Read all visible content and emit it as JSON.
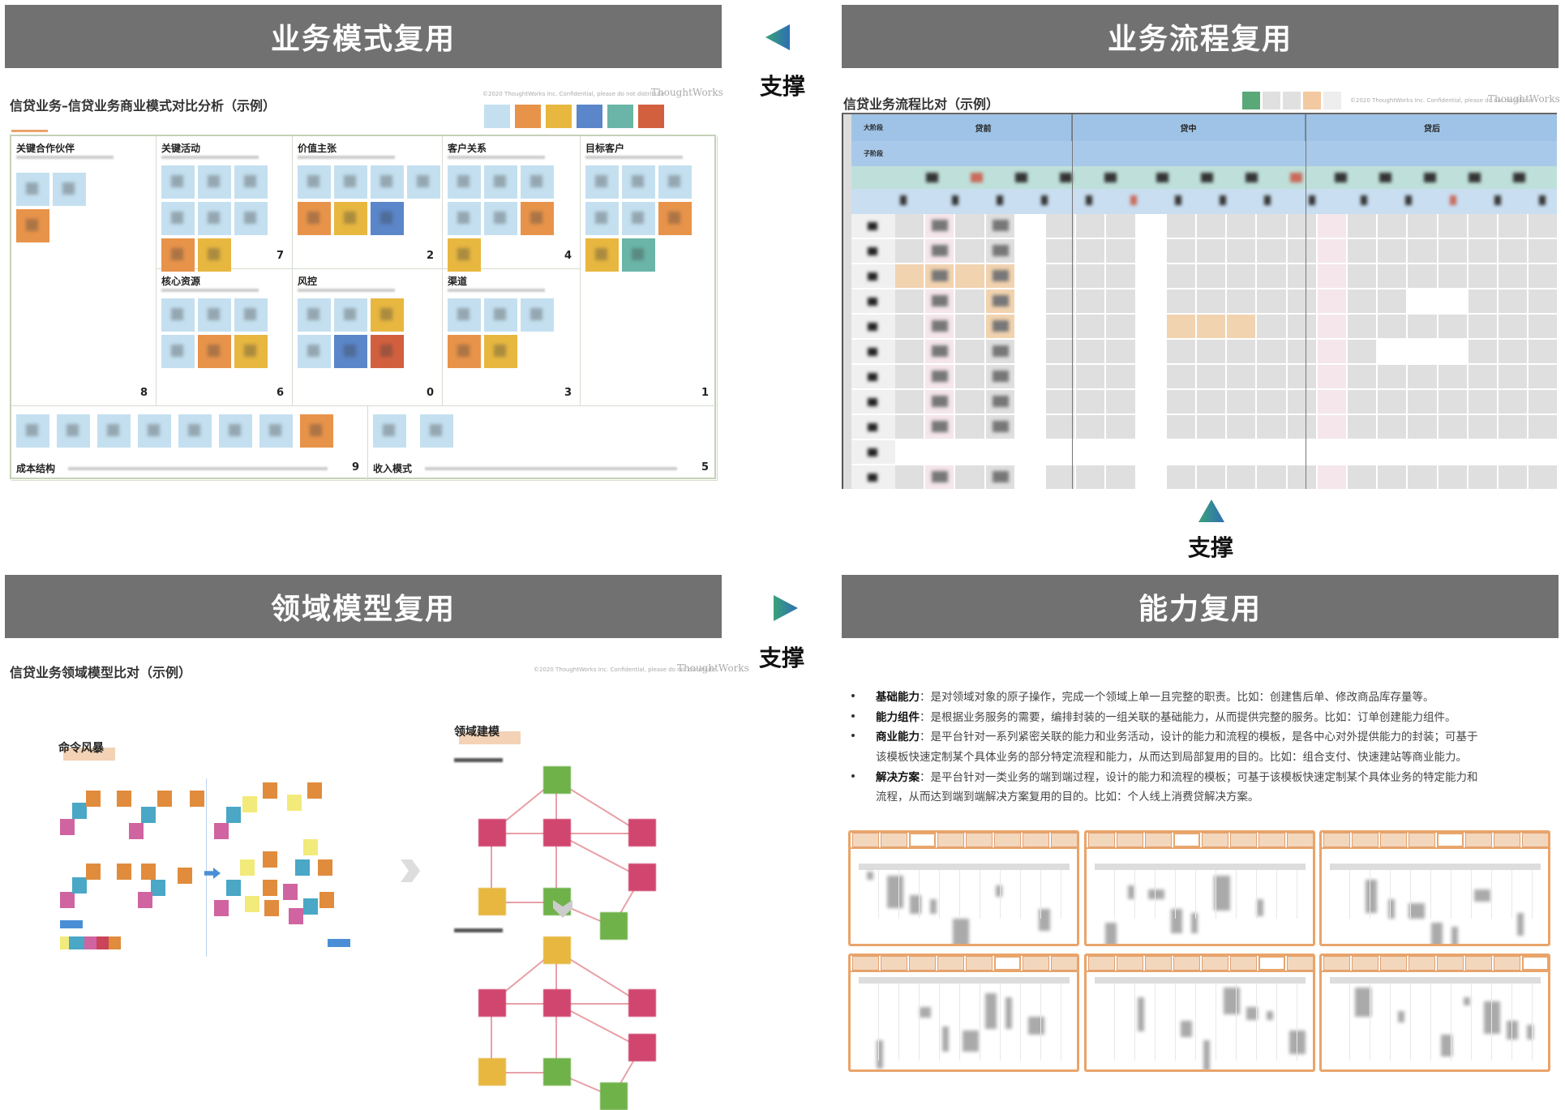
{
  "panels": {
    "business_model": {
      "header": "业务模式复用",
      "title": "信贷业务–信贷业务商业模式对比分析（示例）",
      "copyright": "©2020 ThoughtWorks Inc. Confidential, please do not distribute",
      "brand": "ThoughtWorks"
    },
    "business_process": {
      "header": "业务流程复用",
      "title": "信贷业务流程比对（示例）",
      "copyright": "©2020 ThoughtWorks Inc. Confidential, please do not distribute",
      "brand": "ThoughtWorks"
    },
    "domain_model": {
      "header": "领域模型复用",
      "title": "信贷业务领域模型比对（示例）",
      "copyright": "©2020 ThoughtWorks Inc. Confidential, please do not distribute",
      "brand": "ThoughtWorks",
      "left_label": "命令风暴",
      "right_label": "领域建模"
    },
    "capability": {
      "header": "能力复用"
    }
  },
  "support_label": "支撑",
  "canvas": {
    "legend_colors": [
      "#c4e0f0",
      "#e8934a",
      "#e7b740",
      "#5b86c9",
      "#6ab5a8",
      "#d2603f"
    ],
    "sections": [
      {
        "name": "关键合作伙伴",
        "count": "8",
        "notes": [
          "b",
          "b",
          "o"
        ]
      },
      {
        "name": "关键活动",
        "count": "7",
        "notes": [
          "b",
          "b",
          "b",
          "b",
          "b",
          "b",
          "o",
          "y"
        ]
      },
      {
        "name": "价值主张",
        "count": "2",
        "notes": [
          "b",
          "b",
          "b",
          "b",
          "o",
          "y",
          "d"
        ]
      },
      {
        "name": "客户关系",
        "count": "4",
        "notes": [
          "b",
          "b",
          "b",
          "b",
          "b",
          "o",
          "y"
        ]
      },
      {
        "name": "目标客户",
        "count": "1",
        "notes": [
          "b",
          "b",
          "b",
          "b",
          "b",
          "o",
          "y",
          "t"
        ]
      },
      {
        "name": "核心资源",
        "count": "6",
        "notes": [
          "b",
          "b",
          "b",
          "b",
          "o",
          "y"
        ]
      },
      {
        "name": "风控",
        "count": "0",
        "notes": [
          "b",
          "b",
          "y",
          "b",
          "d",
          "r"
        ]
      },
      {
        "name": "渠道",
        "count": "3",
        "notes": [
          "b",
          "b",
          "b",
          "o",
          "y"
        ]
      },
      {
        "name": "成本结构",
        "count": "9",
        "notes": [
          "b",
          "b",
          "b",
          "b",
          "b",
          "b",
          "b",
          "o"
        ]
      },
      {
        "name": "收入模式",
        "count": "5",
        "notes": [
          "b",
          "b"
        ]
      }
    ]
  },
  "process_table": {
    "header_stage": "大阶段",
    "header_substage": "子阶段",
    "phases": [
      "贷前",
      "贷中",
      "贷后"
    ]
  },
  "capability_bullets": [
    {
      "term": "基础能力",
      "text": "：是对领域对象的原子操作，完成一个领域上单一且完整的职责。比如：创建售后单、修改商品库存量等。"
    },
    {
      "term": "能力组件",
      "text": "：是根据业务服务的需要，编排封装的一组关联的基础能力，从而提供完整的服务。比如：订单创建能力组件。"
    },
    {
      "term": "商业能力",
      "text": "：是平台针对一系列紧密关联的能力和业务活动，设计的能力和流程的模板，是各中心对外提供能力的封装；可基于",
      "cont": "该模板快速定制某个具体业务的部分特定流程和能力，从而达到局部复用的目的。比如：组合支付、快速建站等商业能力。"
    },
    {
      "term": "解决方案",
      "text": "：是平台针对一类业务的端到端过程，设计的能力和流程的模板；可基于该模板快速定制某个具体业务的特定能力和",
      "cont": "流程，从而达到端到端解决方案复用的目的。比如：个人线上消费贷解决方案。"
    }
  ],
  "thumbnails": {
    "count": 6,
    "tabs_per_thumb": 8,
    "active_tabs": [
      2,
      3,
      4,
      5,
      6,
      7
    ]
  },
  "colors": {
    "header_bg": "#717171",
    "b": "#c4e0f0",
    "o": "#e8934a",
    "y": "#e7b740",
    "d": "#5b86c9",
    "t": "#6ab5a8",
    "r": "#d2603f",
    "pink": "#d0466e",
    "green": "#6fb24a",
    "accent": "#e9a46a"
  }
}
